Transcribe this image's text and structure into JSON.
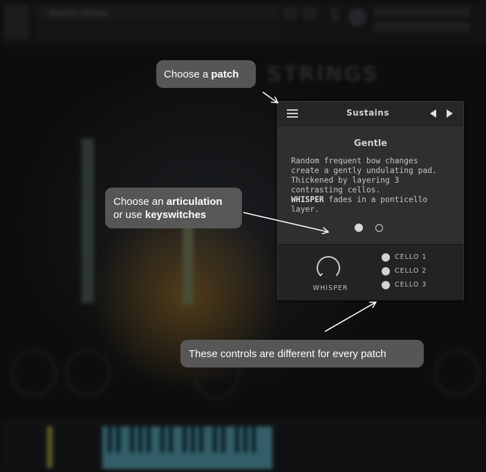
{
  "background": {
    "instrument_title": "STRINGS",
    "track_name": "Shadow Strings",
    "meter_value": 0.72
  },
  "callouts": {
    "patch": {
      "prefix": "Choose a ",
      "bold": "patch"
    },
    "articulation": {
      "line1_prefix": "Choose an ",
      "line1_bold": "articulation",
      "line2_prefix": "or use ",
      "line2_bold": "keyswitches"
    },
    "controls": {
      "text": "These controls are different for every patch"
    }
  },
  "panel": {
    "patch_name": "Sustains",
    "articulation_name": "Gentle",
    "description": {
      "lines": [
        "Random frequent bow changes",
        "create a gently undulating pad.",
        "Thickened by layering 3",
        "contrasting cellos."
      ],
      "highlight": "WHISPER",
      "tail": " fades in a ponticello",
      "last_line": "layer."
    },
    "articulation_pages": [
      {
        "active": true
      },
      {
        "active": false
      }
    ],
    "knob": {
      "label": "WHISPER"
    },
    "cellos": [
      {
        "label": "CELLO 1",
        "on": true
      },
      {
        "label": "CELLO 2",
        "on": true
      },
      {
        "label": "CELLO 3",
        "on": true
      }
    ]
  },
  "colors": {
    "callout_bg": "#5c5c5c",
    "panel_bg": "#2a2a2a",
    "text": "#ffffff"
  }
}
